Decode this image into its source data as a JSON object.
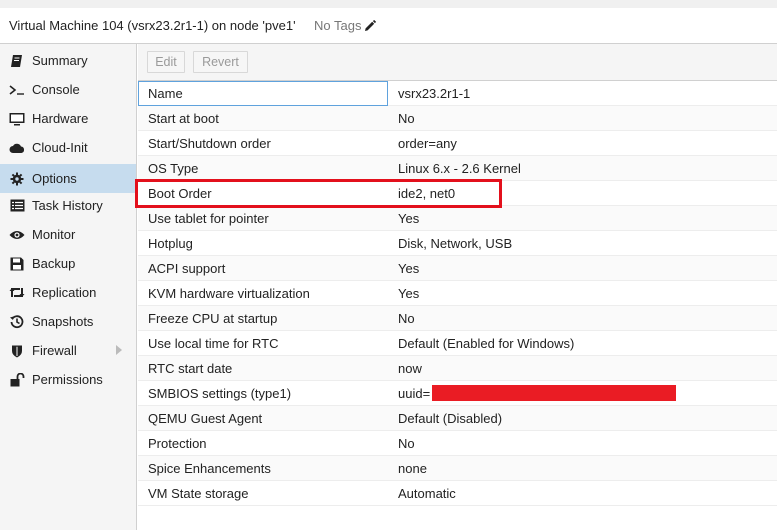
{
  "header": {
    "title": "Virtual Machine 104 (vsrx23.2r1-1) on node 'pve1'",
    "tags_label": "No Tags",
    "edit_tags_icon": "pencil-icon"
  },
  "sidebar": {
    "items": [
      {
        "label": "Summary",
        "icon": "book-icon"
      },
      {
        "label": "Console",
        "icon": "terminal-icon"
      },
      {
        "label": "Hardware",
        "icon": "monitor-icon"
      },
      {
        "label": "Cloud-Init",
        "icon": "cloud-icon"
      },
      {
        "label": "Options",
        "icon": "gear-icon",
        "selected": true
      },
      {
        "label": "Task History",
        "icon": "list-icon"
      },
      {
        "label": "Monitor",
        "icon": "eye-icon"
      },
      {
        "label": "Backup",
        "icon": "floppy-icon"
      },
      {
        "label": "Replication",
        "icon": "retweet-icon"
      },
      {
        "label": "Snapshots",
        "icon": "history-icon"
      },
      {
        "label": "Firewall",
        "icon": "shield-icon",
        "has_submenu": true
      },
      {
        "label": "Permissions",
        "icon": "unlock-icon"
      }
    ]
  },
  "toolbar": {
    "edit_label": "Edit",
    "revert_label": "Revert"
  },
  "options": [
    {
      "key": "Name",
      "value": "vsrx23.2r1-1"
    },
    {
      "key": "Start at boot",
      "value": "No"
    },
    {
      "key": "Start/Shutdown order",
      "value": "order=any"
    },
    {
      "key": "OS Type",
      "value": "Linux 6.x - 2.6 Kernel"
    },
    {
      "key": "Boot Order",
      "value": "ide2, net0"
    },
    {
      "key": "Use tablet for pointer",
      "value": "Yes"
    },
    {
      "key": "Hotplug",
      "value": "Disk, Network, USB"
    },
    {
      "key": "ACPI support",
      "value": "Yes"
    },
    {
      "key": "KVM hardware virtualization",
      "value": "Yes"
    },
    {
      "key": "Freeze CPU at startup",
      "value": "No"
    },
    {
      "key": "Use local time for RTC",
      "value": "Default (Enabled for Windows)"
    },
    {
      "key": "RTC start date",
      "value": "now"
    },
    {
      "key": "SMBIOS settings (type1)",
      "value": "uuid="
    },
    {
      "key": "QEMU Guest Agent",
      "value": "Default (Disabled)"
    },
    {
      "key": "Protection",
      "value": "No"
    },
    {
      "key": "Spice Enhancements",
      "value": "none"
    },
    {
      "key": "VM State storage",
      "value": "Automatic"
    }
  ],
  "colors": {
    "selection": "#c6dcee",
    "annotation_red": "#e3101c"
  }
}
